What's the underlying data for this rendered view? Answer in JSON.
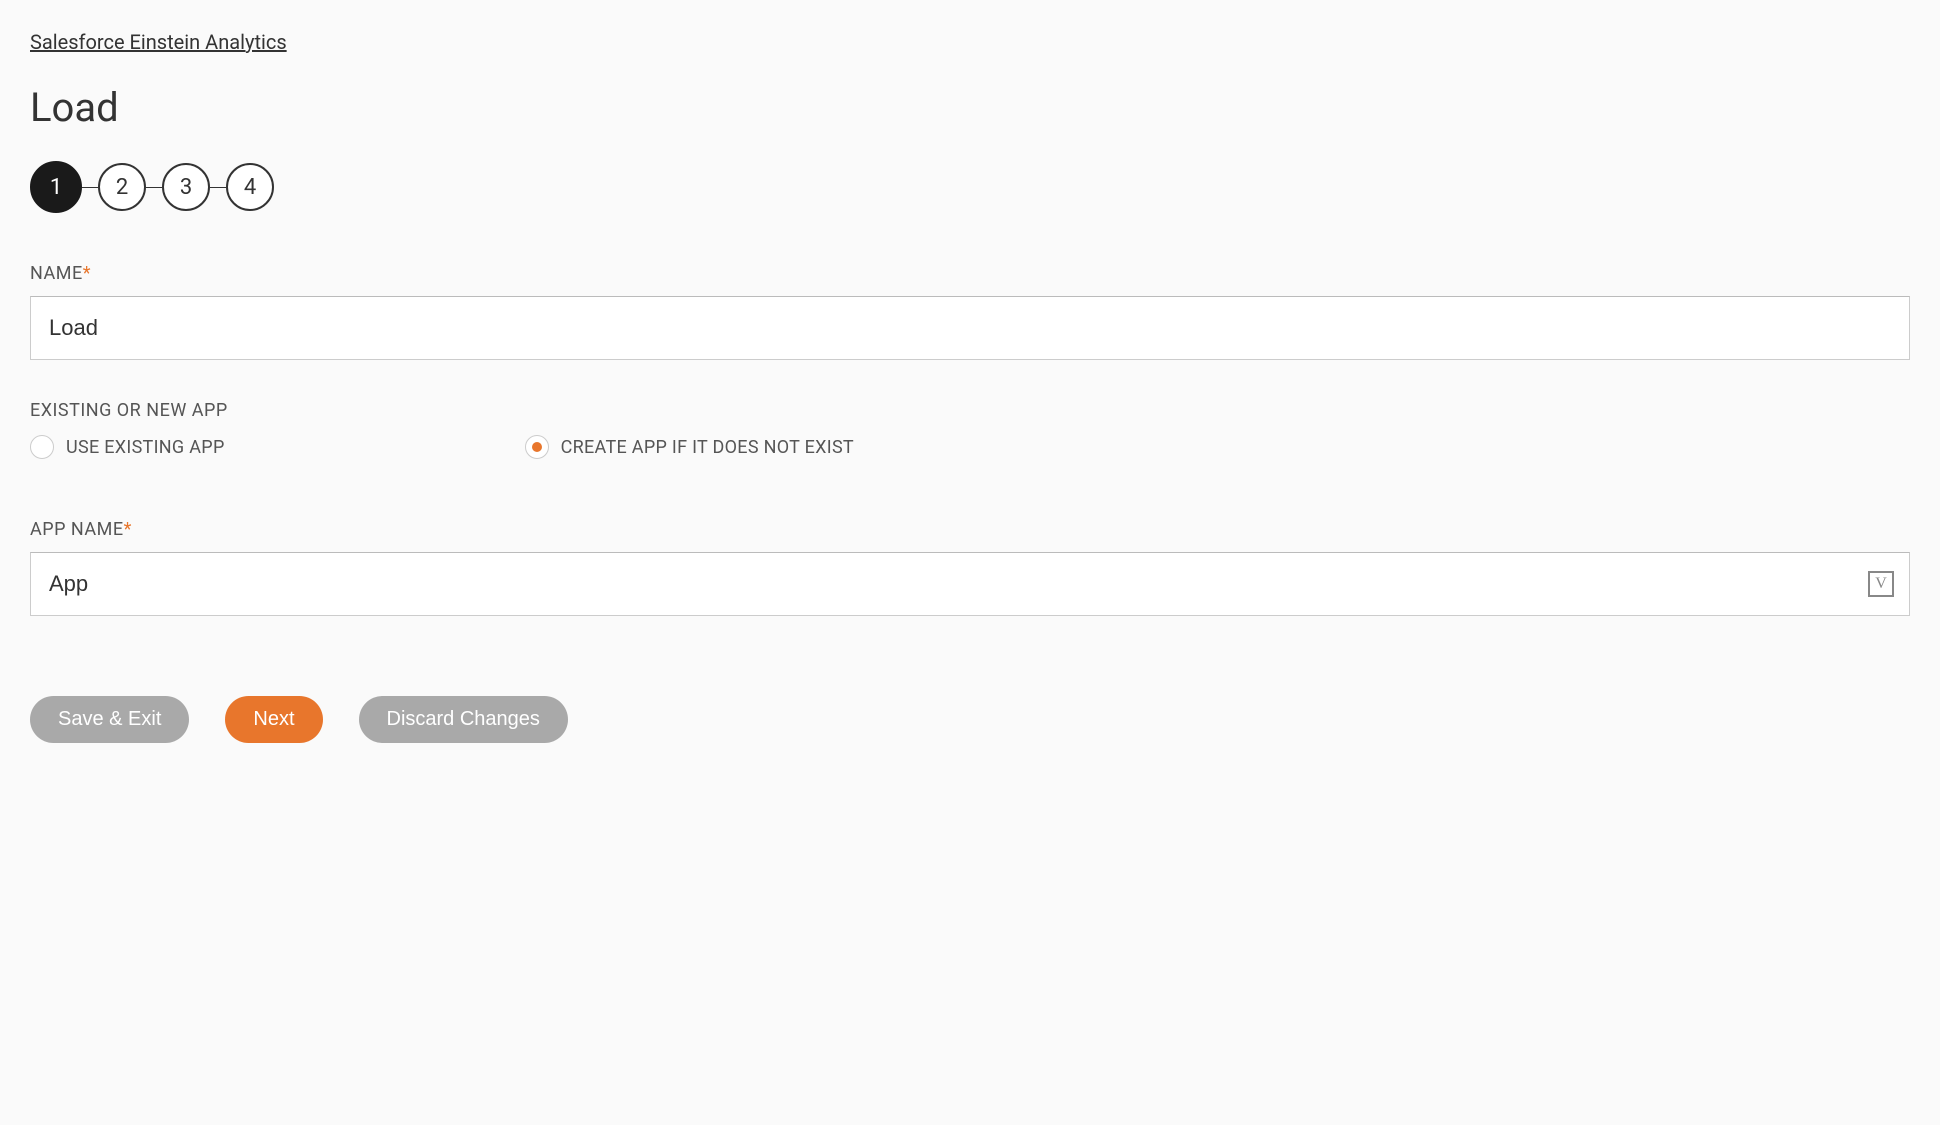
{
  "breadcrumb": "Salesforce Einstein Analytics",
  "page_title": "Load",
  "stepper": {
    "steps": [
      "1",
      "2",
      "3",
      "4"
    ],
    "active_index": 0
  },
  "fields": {
    "name": {
      "label": "NAME",
      "required_mark": "*",
      "value": "Load"
    },
    "existing_or_new": {
      "label": "EXISTING OR NEW APP",
      "options": {
        "use_existing": "USE EXISTING APP",
        "create_if_not_exist": "CREATE APP IF IT DOES NOT EXIST"
      },
      "selected": "create_if_not_exist"
    },
    "app_name": {
      "label": "APP NAME",
      "required_mark": "*",
      "value": "App",
      "icon_label": "V"
    }
  },
  "buttons": {
    "save_exit": "Save & Exit",
    "next": "Next",
    "discard": "Discard Changes"
  }
}
